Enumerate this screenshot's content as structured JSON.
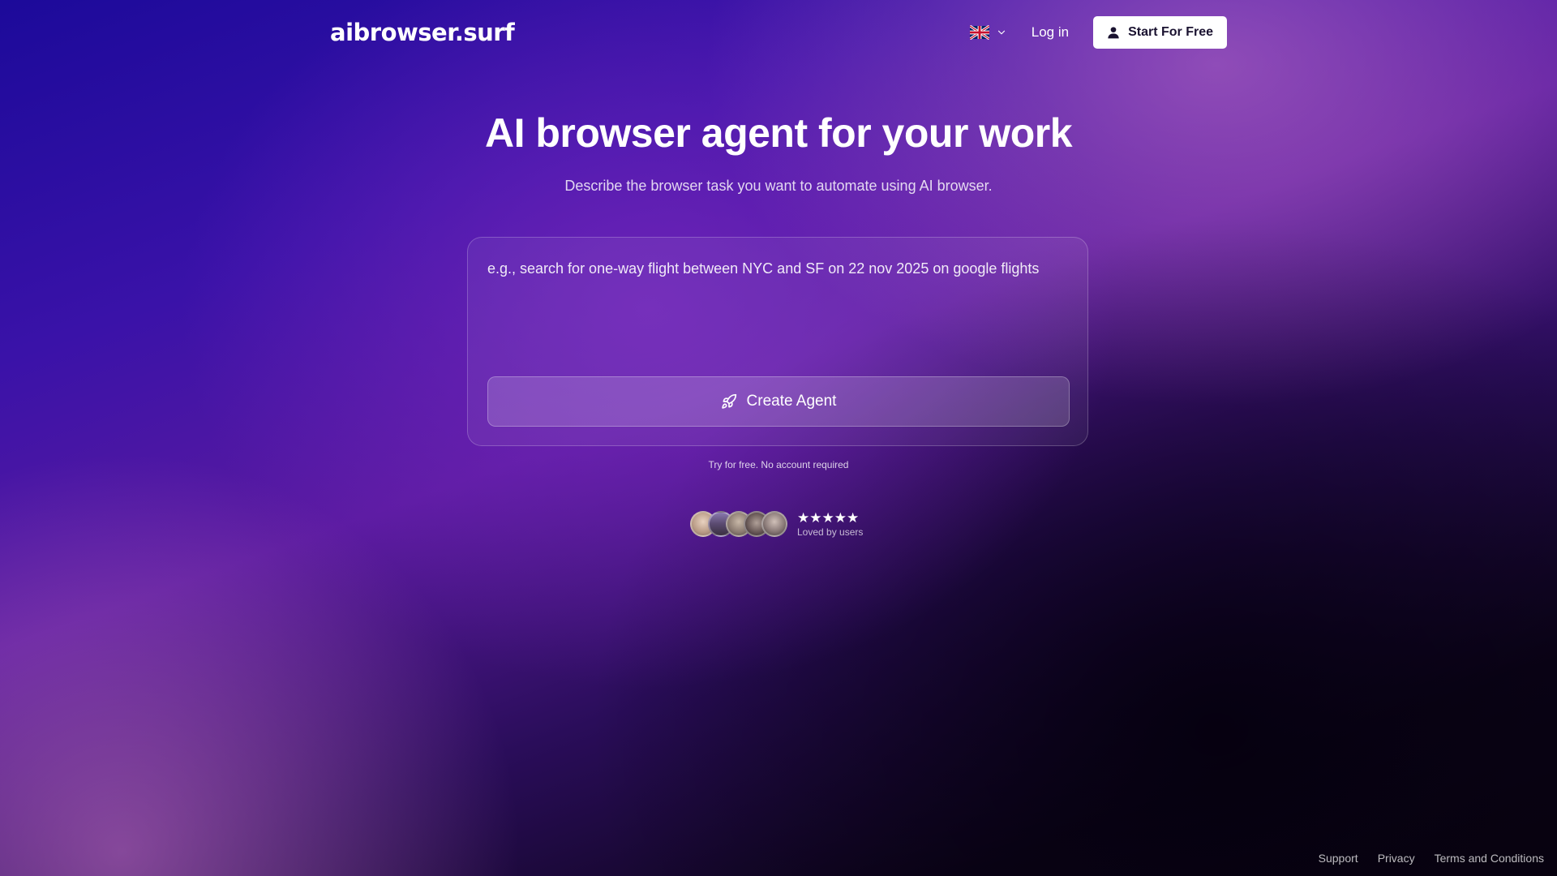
{
  "header": {
    "logo_text": "aibrowser.surf",
    "language": {
      "icon": "uk-flag-icon",
      "dropdown_icon": "chevron-down-icon"
    },
    "login_label": "Log in",
    "start_label": "Start For Free",
    "start_icon": "user-icon"
  },
  "hero": {
    "title": "AI browser agent for your work",
    "subtitle": "Describe the browser task you want to automate using AI browser."
  },
  "prompt": {
    "value": "",
    "placeholder": "e.g., search for one-way flight between NYC and SF on 22 nov 2025 on google flights",
    "button_label": "Create Agent",
    "button_icon": "rocket-icon"
  },
  "free_note": "Try for free. No account required",
  "social_proof": {
    "avatar_count": 5,
    "rating": 5,
    "stars": "★★★★★",
    "label": "Loved by users"
  },
  "footer": {
    "links": [
      "Support",
      "Privacy",
      "Terms and Conditions"
    ]
  },
  "colors": {
    "button_bg": "#ffffff",
    "button_text": "#1a1230",
    "text": "#ffffff",
    "bg_top_left": "#1c0a9a",
    "bg_mid": "#5a1aa0",
    "bg_bottom_right": "#09030f"
  }
}
